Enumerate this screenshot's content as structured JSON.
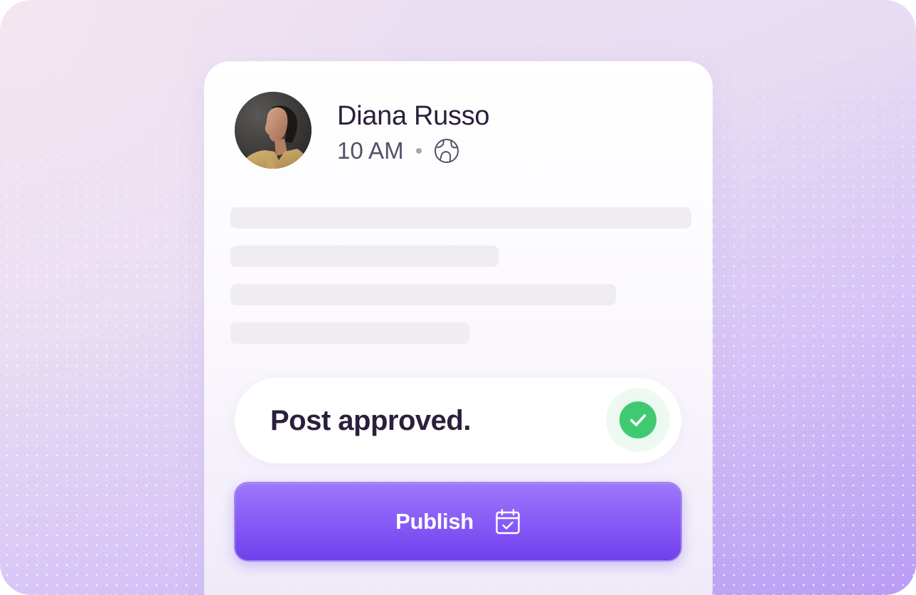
{
  "post": {
    "author_name": "Diana Russo",
    "time": "10 AM",
    "visibility_icon": "globe-icon",
    "avatar_icon": "avatar-photo",
    "body_placeholder_lines": 4
  },
  "status": {
    "text": "Post approved.",
    "icon": "check-circle-icon"
  },
  "publish_button": {
    "label": "Publish",
    "icon": "calendar-check-icon"
  },
  "colors": {
    "accent": "#8658f5",
    "success": "#3fca72",
    "text_primary": "#2a1f3d",
    "text_secondary": "#565067",
    "skeleton": "#efedf2"
  }
}
